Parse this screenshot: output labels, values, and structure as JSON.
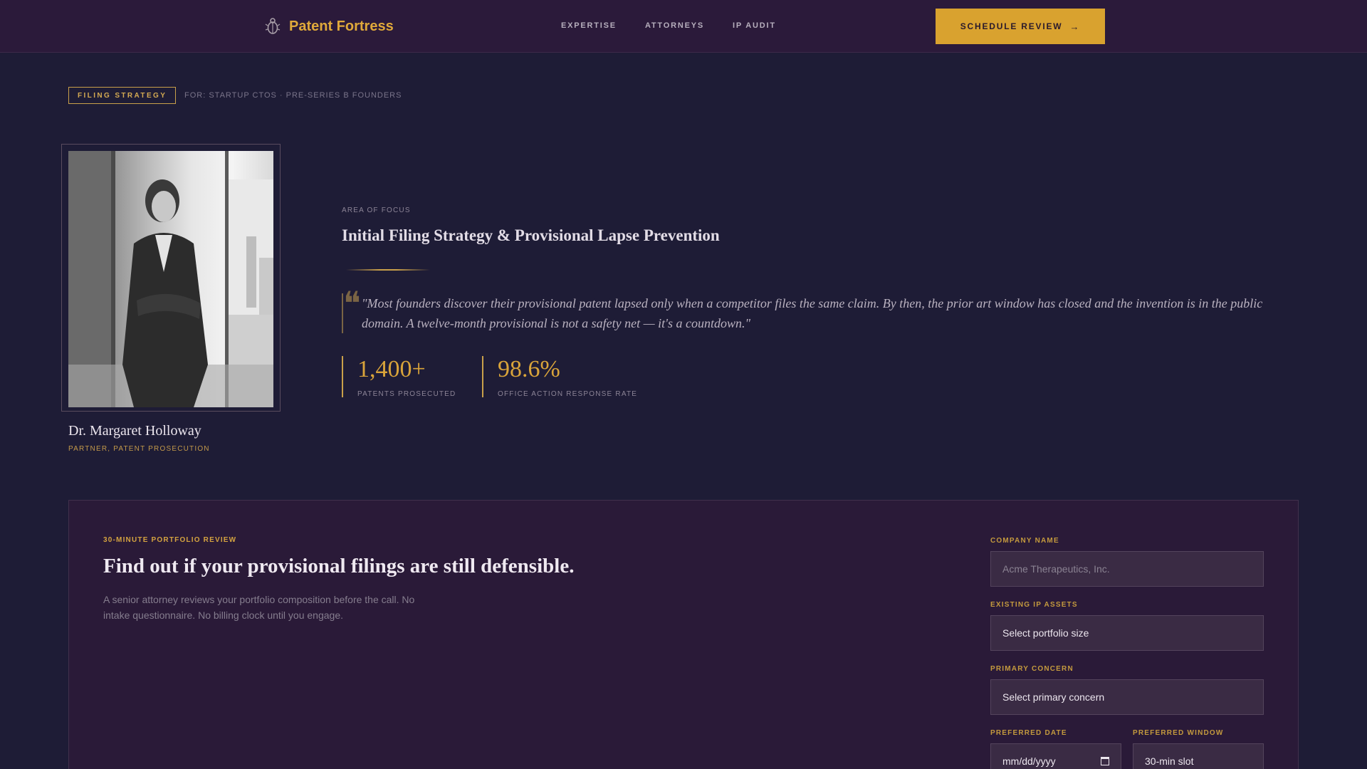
{
  "header": {
    "brand": "Patent Fortress",
    "nav": [
      "EXPERTISE",
      "ATTORNEYS",
      "IP AUDIT"
    ],
    "cta_label": "SCHEDULE REVIEW",
    "cta_arrow": "→"
  },
  "tag": {
    "label": "FILING STRATEGY",
    "audience": "FOR: STARTUP CTOS · PRE-SERIES B FOUNDERS"
  },
  "attorney": {
    "name": "Dr. Margaret Holloway",
    "role": "PARTNER, PATENT PROSECUTION"
  },
  "focus": {
    "label": "AREA OF FOCUS",
    "title": "Initial Filing Strategy & Provisional Lapse Prevention",
    "quote_mark": "❝",
    "quote": "\"Most founders discover their provisional patent lapsed only when a competitor files the same claim. By then, the prior art window has closed and the invention is in the public domain. A twelve-month provisional is not a safety net — it's a countdown.\""
  },
  "stats": [
    {
      "value": "1,400+",
      "label": "PATENTS PROSECUTED"
    },
    {
      "value": "98.6%",
      "label": "OFFICE ACTION RESPONSE RATE"
    }
  ],
  "booking": {
    "eyebrow": "30-MINUTE PORTFOLIO REVIEW",
    "title": "Find out if your provisional filings are still defensible.",
    "description": "A senior attorney reviews your portfolio composition before the call. No intake questionnaire. No billing clock until you engage.",
    "fields": {
      "company_label": "COMPANY NAME",
      "company_placeholder": "Acme Therapeutics, Inc.",
      "ip_label": "EXISTING IP ASSETS",
      "ip_value": "Select portfolio size",
      "concern_label": "PRIMARY CONCERN",
      "concern_value": "Select primary concern",
      "date_label": "PREFERRED DATE",
      "date_value": "mm/dd/yyyy",
      "window_label": "PREFERRED WINDOW",
      "window_value": "30-min slot"
    }
  },
  "colors": {
    "accent": "#d9a22f",
    "background": "#1e1c36",
    "header": "#2b1a3a",
    "panel": "#2a1a38"
  },
  "icons": {
    "logo": "beetle-icon",
    "cta": "arrow-right-icon",
    "date": "calendar-icon"
  }
}
